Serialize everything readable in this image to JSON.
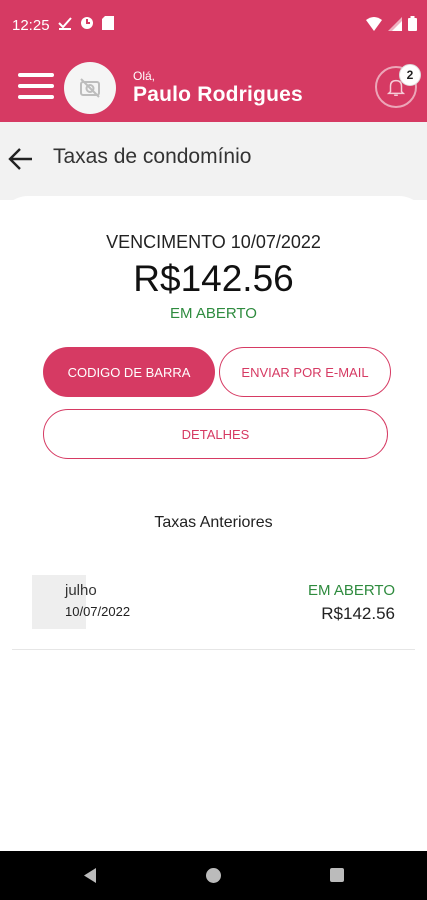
{
  "status_bar": {
    "time": "12:25"
  },
  "header": {
    "greeting": "Olá,",
    "user_name": "Paulo Rodrigues",
    "notification_count": "2",
    "brand_color": "#d63a63"
  },
  "page": {
    "title": "Taxas de condomínio"
  },
  "current_fee": {
    "due_label": "VENCIMENTO 10/07/2022",
    "amount": "R$142.56",
    "status": "EM ABERTO",
    "status_color": "#2e8b3e"
  },
  "actions": {
    "barcode": "CODIGO DE BARRA",
    "email": "ENVIAR POR E-MAIL",
    "details": "DETALHES"
  },
  "previous": {
    "title": "Taxas Anteriores",
    "items": [
      {
        "month": "julho",
        "date": "10/07/2022",
        "status": "EM ABERTO",
        "amount": "R$142.56"
      }
    ]
  },
  "icons": [
    "menu-icon",
    "no-photo-icon",
    "bell-icon",
    "arrow-left-icon",
    "nav-back-icon",
    "nav-home-icon",
    "nav-recents-icon"
  ]
}
